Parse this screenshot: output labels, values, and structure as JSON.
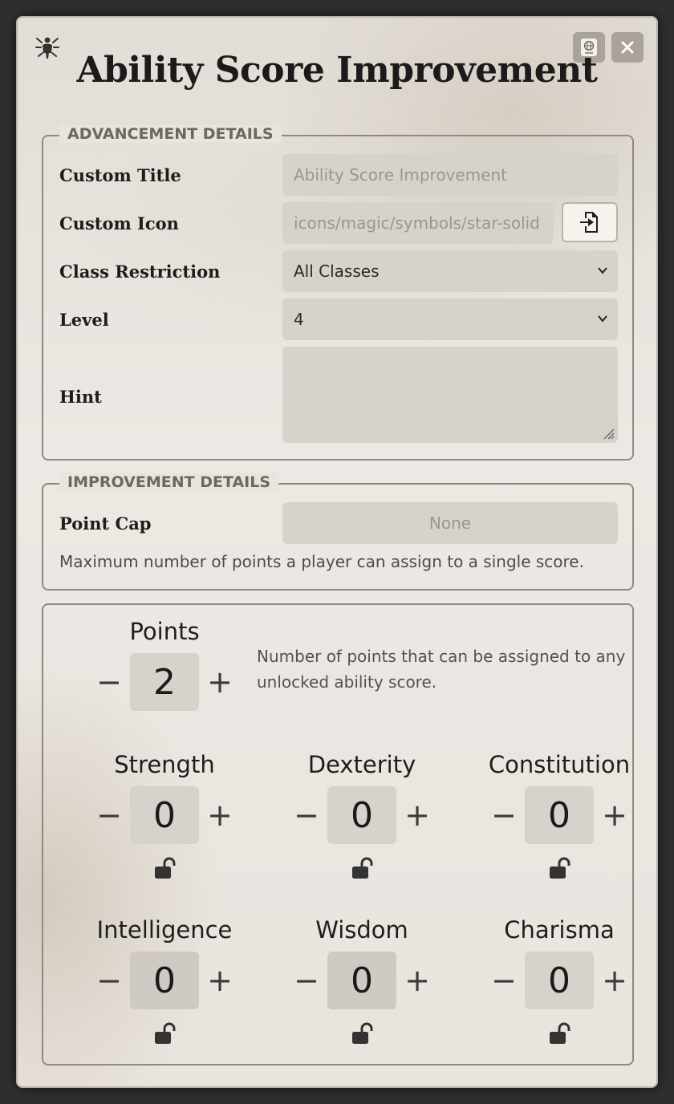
{
  "window": {
    "title": "Ability Score Improvement",
    "header_icon": "vitruvian-figure-icon",
    "lang_icon": "globe-icon",
    "close_icon": "close-icon"
  },
  "advancement": {
    "legend": "ADVANCEMENT DETAILS",
    "custom_title": {
      "label": "Custom Title",
      "placeholder": "Ability Score Improvement"
    },
    "custom_icon": {
      "label": "Custom Icon",
      "placeholder": "icons/magic/symbols/star-solid",
      "button_icon": "file-import-icon"
    },
    "class_restriction": {
      "label": "Class Restriction",
      "value": "All Classes"
    },
    "level": {
      "label": "Level",
      "value": "4"
    },
    "hint": {
      "label": "Hint",
      "value": ""
    }
  },
  "improvement": {
    "legend": "IMPROVEMENT DETAILS",
    "point_cap": {
      "label": "Point Cap",
      "placeholder": "None"
    },
    "point_cap_hint": "Maximum number of points a player can assign to a single score."
  },
  "points": {
    "label": "Points",
    "value": "2",
    "minus": "−",
    "plus": "+",
    "description": "Number of points that can be assigned to any unlocked ability score."
  },
  "abilities": [
    {
      "name": "Strength",
      "value": "0",
      "minus": "−",
      "plus": "+",
      "lock_icon": "unlocked-padlock-icon"
    },
    {
      "name": "Dexterity",
      "value": "0",
      "minus": "−",
      "plus": "+",
      "lock_icon": "unlocked-padlock-icon"
    },
    {
      "name": "Constitution",
      "value": "0",
      "minus": "−",
      "plus": "+",
      "lock_icon": "unlocked-padlock-icon"
    },
    {
      "name": "Intelligence",
      "value": "0",
      "minus": "−",
      "plus": "+",
      "lock_icon": "unlocked-padlock-icon"
    },
    {
      "name": "Wisdom",
      "value": "0",
      "minus": "−",
      "plus": "+",
      "lock_icon": "unlocked-padlock-icon"
    },
    {
      "name": "Charisma",
      "value": "0",
      "minus": "−",
      "plus": "+",
      "lock_icon": "unlocked-padlock-icon"
    }
  ],
  "colors": {
    "panel": "#e8e4de",
    "field": "#d6d2cc",
    "border": "#8e8a84",
    "text": "#1d1d1d"
  }
}
